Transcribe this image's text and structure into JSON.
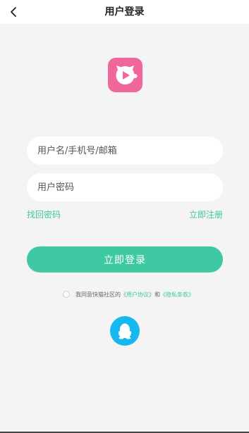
{
  "header": {
    "title": "用户登录",
    "back_icon": "chevron-left-icon"
  },
  "logo": {
    "icon": "kuaimao-cat-play-logo",
    "color": "#f0679b"
  },
  "form": {
    "username_placeholder": "用户名/手机号/邮箱",
    "password_placeholder": "用户密码",
    "forgot_password": "找回密码",
    "register": "立即注册",
    "login_button": "立即登录"
  },
  "agreement": {
    "prefix": "我同意快猫社区的",
    "user_agreement": "《用户协议》",
    "conjunction": "和",
    "privacy_policy": "《隐私条款》"
  },
  "social": {
    "qq_icon": "qq-penguin-icon",
    "qq_color": "#16b8f0"
  },
  "colors": {
    "accent": "#3fc9a2",
    "background": "#f4f4f4"
  }
}
